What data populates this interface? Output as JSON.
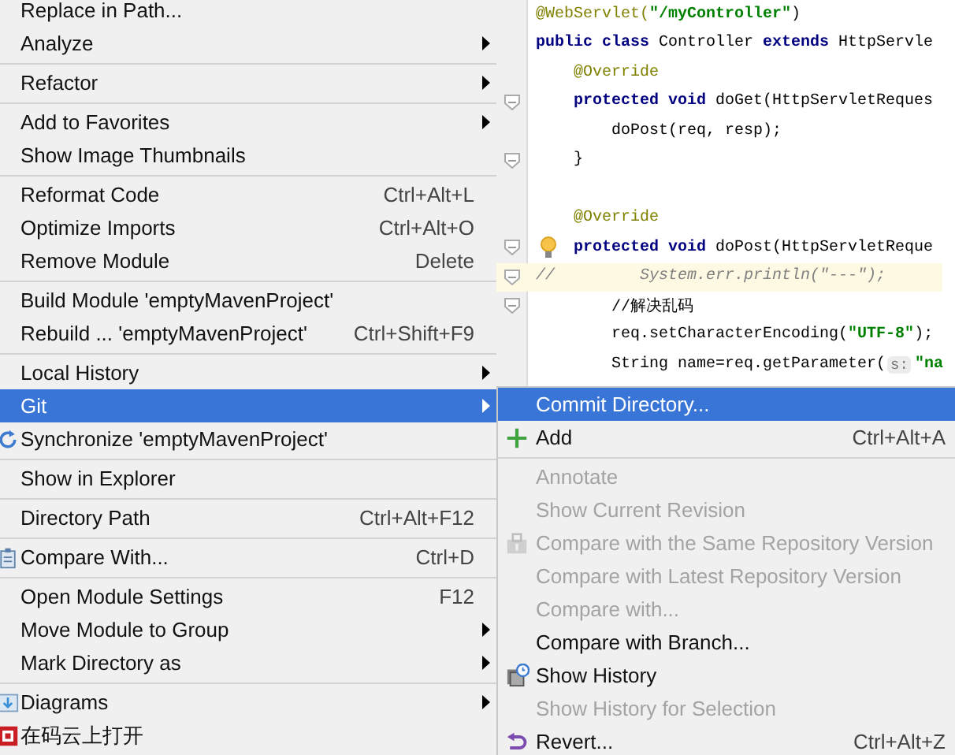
{
  "context_menu": {
    "items": [
      {
        "kind": "item",
        "label": "Replace in Path...",
        "selected": false
      },
      {
        "kind": "item",
        "label": "Analyze",
        "submenu": true,
        "selected": false
      },
      {
        "kind": "separator"
      },
      {
        "kind": "item",
        "label": "Refactor",
        "submenu": true,
        "selected": false
      },
      {
        "kind": "separator"
      },
      {
        "kind": "item",
        "label": "Add to Favorites",
        "submenu": true,
        "selected": false
      },
      {
        "kind": "item",
        "label": "Show Image Thumbnails",
        "selected": false
      },
      {
        "kind": "separator"
      },
      {
        "kind": "item",
        "label": "Reformat Code",
        "shortcut": "Ctrl+Alt+L",
        "selected": false
      },
      {
        "kind": "item",
        "label": "Optimize Imports",
        "shortcut": "Ctrl+Alt+O",
        "selected": false
      },
      {
        "kind": "item",
        "label": "Remove Module",
        "shortcut": "Delete",
        "selected": false
      },
      {
        "kind": "separator"
      },
      {
        "kind": "item",
        "label": "Build Module 'emptyMavenProject'",
        "selected": false
      },
      {
        "kind": "item",
        "label": "Rebuild ... 'emptyMavenProject'",
        "shortcut": "Ctrl+Shift+F9",
        "selected": false
      },
      {
        "kind": "separator"
      },
      {
        "kind": "item",
        "label": "Local History",
        "submenu": true,
        "selected": false
      },
      {
        "kind": "item",
        "label": "Git",
        "submenu": true,
        "selected": true
      },
      {
        "kind": "item",
        "label": "Synchronize 'emptyMavenProject'",
        "selected": false
      },
      {
        "kind": "separator"
      },
      {
        "kind": "item",
        "label": "Show in Explorer",
        "selected": false
      },
      {
        "kind": "separator"
      },
      {
        "kind": "item",
        "label": "Directory Path",
        "shortcut": "Ctrl+Alt+F12",
        "selected": false
      },
      {
        "kind": "separator"
      },
      {
        "kind": "item",
        "label": "Compare With...",
        "shortcut": "Ctrl+D",
        "selected": false
      },
      {
        "kind": "separator"
      },
      {
        "kind": "item",
        "label": "Open Module Settings",
        "shortcut": "F12",
        "selected": false
      },
      {
        "kind": "item",
        "label": "Move Module to Group",
        "submenu": true,
        "selected": false
      },
      {
        "kind": "item",
        "label": "Mark Directory as",
        "submenu": true,
        "selected": false
      },
      {
        "kind": "separator"
      },
      {
        "kind": "item",
        "label": "Diagrams",
        "submenu": true,
        "selected": false
      },
      {
        "kind": "item",
        "label": "在码云上打开",
        "selected": false
      }
    ]
  },
  "editor": {
    "lines": [
      {
        "segments": [
          {
            "kind": "annotation",
            "text": "@WebServlet("
          },
          {
            "kind": "string",
            "text": "\"/myController\""
          },
          {
            "kind": "plain",
            "text": ")"
          }
        ]
      },
      {
        "segments": [
          {
            "kind": "keyword",
            "text": "public class "
          },
          {
            "kind": "plain",
            "text": "Controller "
          },
          {
            "kind": "keyword",
            "text": "extends "
          },
          {
            "kind": "plain",
            "text": "HttpServle"
          }
        ]
      },
      {
        "segments": [
          {
            "kind": "annotation",
            "text": "    @Override"
          }
        ]
      },
      {
        "fold": true,
        "segments": [
          {
            "kind": "keyword",
            "text": "    protected void "
          },
          {
            "kind": "plain",
            "text": "doGet(HttpServletReques"
          }
        ]
      },
      {
        "segments": [
          {
            "kind": "plain",
            "text": "        doPost(req, resp);"
          }
        ]
      },
      {
        "fold": true,
        "segments": [
          {
            "kind": "plain",
            "text": "    }"
          }
        ]
      },
      {
        "blank": true
      },
      {
        "segments": [
          {
            "kind": "annotation",
            "text": "    @Override"
          }
        ]
      },
      {
        "fold": true,
        "bulb": true,
        "segments": [
          {
            "kind": "keyword",
            "text": "    protected void "
          },
          {
            "kind": "plain",
            "text": "doPost(HttpServletReque"
          }
        ]
      },
      {
        "fold": true,
        "highlighted": true,
        "segments": [
          {
            "kind": "comment",
            "text": "//         System.err.println(\"---\");"
          }
        ]
      },
      {
        "fold": true,
        "segments": [
          {
            "kind": "plain",
            "text": "        //解决乱码"
          }
        ]
      },
      {
        "segments": [
          {
            "kind": "plain",
            "text": "        req.setCharacterEncoding("
          },
          {
            "kind": "string",
            "text": "\"UTF-8\""
          },
          {
            "kind": "plain",
            "text": ");"
          }
        ]
      },
      {
        "segments": [
          {
            "kind": "plain",
            "text": "        String name=req.getParameter("
          },
          {
            "kind": "hint",
            "text": "s:"
          },
          {
            "kind": "string",
            "text": "\"na"
          }
        ]
      }
    ]
  },
  "git_submenu": {
    "items": [
      {
        "kind": "item",
        "label": "Commit Directory...",
        "selected": true,
        "disabled": false
      },
      {
        "kind": "item",
        "label": "Add",
        "shortcut": "Ctrl+Alt+A",
        "selected": false,
        "disabled": false
      },
      {
        "kind": "separator"
      },
      {
        "kind": "item",
        "label": "Annotate",
        "selected": false,
        "disabled": true
      },
      {
        "kind": "item",
        "label": "Show Current Revision",
        "selected": false,
        "disabled": true
      },
      {
        "kind": "item",
        "label": "Compare with the Same Repository Version",
        "selected": false,
        "disabled": true
      },
      {
        "kind": "item",
        "label": "Compare with Latest Repository Version",
        "selected": false,
        "disabled": true
      },
      {
        "kind": "item",
        "label": "Compare with...",
        "selected": false,
        "disabled": true
      },
      {
        "kind": "item",
        "label": "Compare with Branch...",
        "selected": false,
        "disabled": false
      },
      {
        "kind": "item",
        "label": "Show History",
        "selected": false,
        "disabled": false
      },
      {
        "kind": "item",
        "label": "Show History for Selection",
        "selected": false,
        "disabled": true
      },
      {
        "kind": "item",
        "label": "Revert...",
        "shortcut": "Ctrl+Alt+Z",
        "selected": false,
        "disabled": false
      }
    ]
  }
}
